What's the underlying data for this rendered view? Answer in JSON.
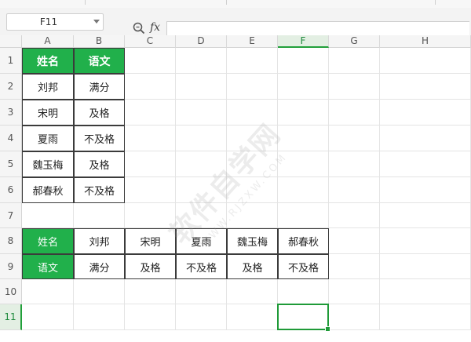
{
  "name_box": {
    "value": "F11"
  },
  "formula_bar": {
    "fx_label": "fx",
    "value": ""
  },
  "columns": [
    "A",
    "B",
    "C",
    "D",
    "E",
    "F",
    "G",
    "H"
  ],
  "rows": [
    "1",
    "2",
    "3",
    "4",
    "5",
    "6",
    "7",
    "8",
    "9",
    "10",
    "11"
  ],
  "selected": {
    "column": "F",
    "row": "11"
  },
  "cells": [
    {
      "ref": "A1",
      "value": "姓名"
    },
    {
      "ref": "B1",
      "value": "语文"
    },
    {
      "ref": "A2",
      "value": "刘邦"
    },
    {
      "ref": "B2",
      "value": "满分"
    },
    {
      "ref": "A3",
      "value": "宋明"
    },
    {
      "ref": "B3",
      "value": "及格"
    },
    {
      "ref": "A4",
      "value": "夏雨"
    },
    {
      "ref": "B4",
      "value": "不及格"
    },
    {
      "ref": "A5",
      "value": "魏玉梅"
    },
    {
      "ref": "B5",
      "value": "及格"
    },
    {
      "ref": "A6",
      "value": "郝春秋"
    },
    {
      "ref": "B6",
      "value": "不及格"
    },
    {
      "ref": "A8",
      "value": "姓名"
    },
    {
      "ref": "B8",
      "value": "刘邦"
    },
    {
      "ref": "C8",
      "value": "宋明"
    },
    {
      "ref": "D8",
      "value": "夏雨"
    },
    {
      "ref": "E8",
      "value": "魏玉梅"
    },
    {
      "ref": "F8",
      "value": "郝春秋"
    },
    {
      "ref": "A9",
      "value": "语文"
    },
    {
      "ref": "B9",
      "value": "满分"
    },
    {
      "ref": "C9",
      "value": "及格"
    },
    {
      "ref": "D9",
      "value": "不及格"
    },
    {
      "ref": "E9",
      "value": "及格"
    },
    {
      "ref": "F9",
      "value": "不及格"
    }
  ],
  "header_fill_color": "#21b04b",
  "accent_color": "#1f9a38",
  "watermark": {
    "title": "软件自学网",
    "url": "WWW.RJZXW.COM"
  }
}
